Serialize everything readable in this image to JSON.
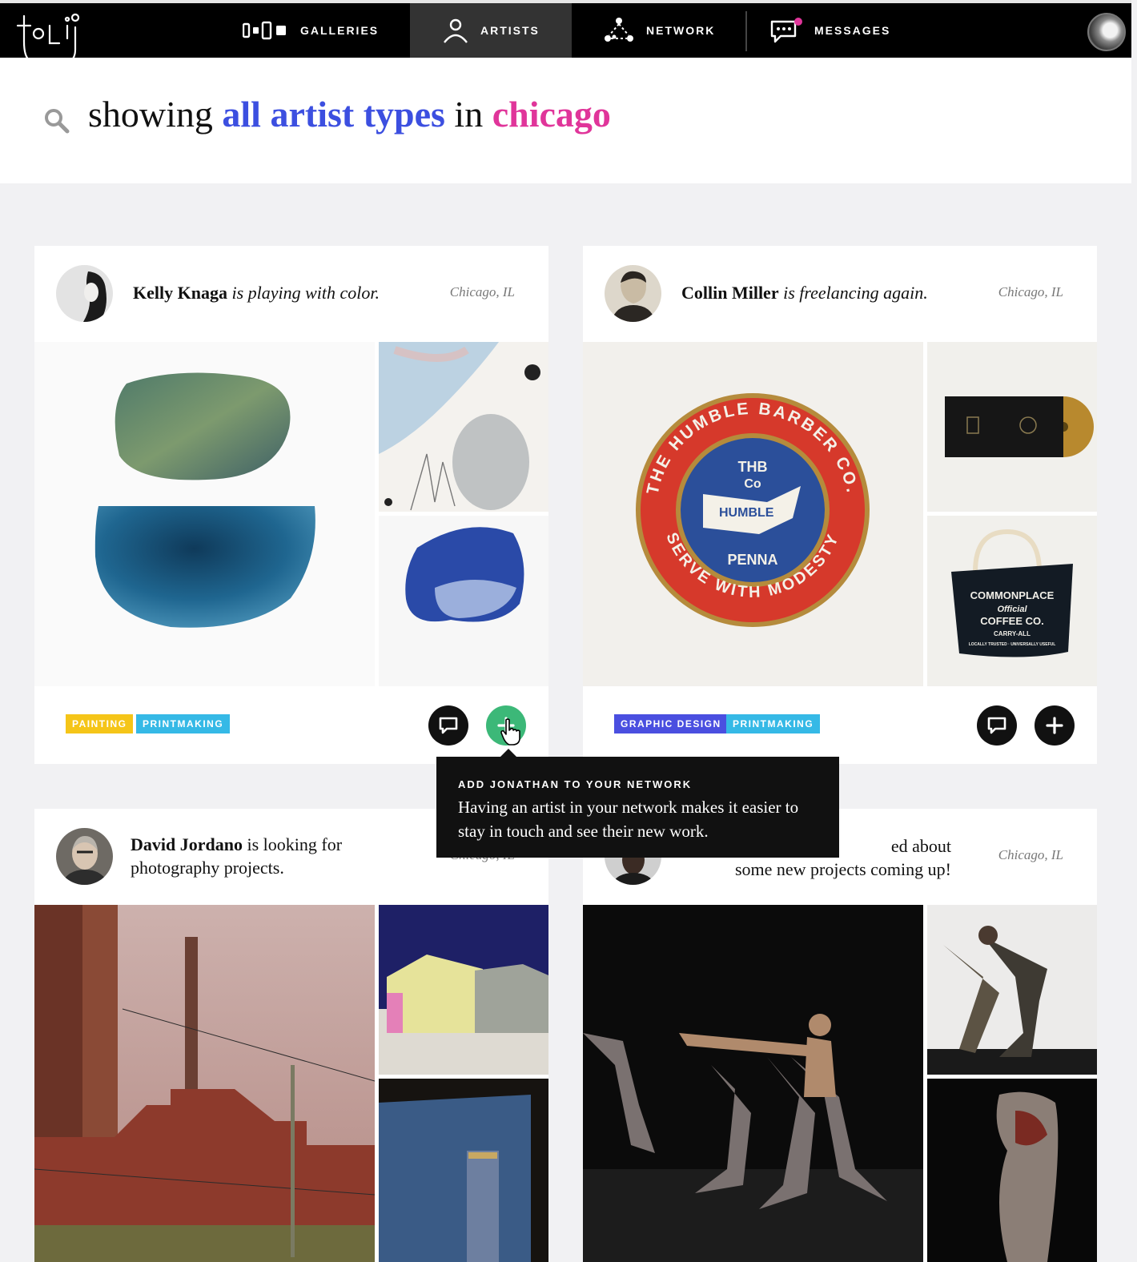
{
  "app": {
    "logo_text": "tolli"
  },
  "nav": {
    "items": [
      {
        "label": "GALLERIES",
        "icon": "galleries-icon"
      },
      {
        "label": "ARTISTS",
        "icon": "artist-icon",
        "active": true
      },
      {
        "label": "NETWORK",
        "icon": "network-icon"
      },
      {
        "label": "MESSAGES",
        "icon": "messages-icon",
        "has_notification": true
      }
    ]
  },
  "search": {
    "prefix": "showing",
    "type": "all artist types",
    "connector": "in",
    "location": "chicago"
  },
  "cards": [
    {
      "name": "Kelly Knaga",
      "status": "is playing with color.",
      "location": "Chicago, IL",
      "tags": [
        "PAINTING",
        "PRINTMAKING"
      ]
    },
    {
      "name": "Collin Miller",
      "status": "is freelancing again.",
      "location": "Chicago, IL",
      "tags": [
        "GRAPHIC DESIGN",
        "PRINTMAKING"
      ]
    },
    {
      "name": "David Jordano",
      "status": "is looking for photography projects.",
      "location": "Chicago, IL"
    },
    {
      "name": "",
      "status_visible": "ed about",
      "status_line2": "some new projects coming up!",
      "location": "Chicago, IL"
    }
  ],
  "tooltip": {
    "title": "ADD JONATHAN TO YOUR NETWORK",
    "body": "Having an artist in your network makes it easier to stay in touch and see their new work."
  },
  "artwork_text": {
    "badge_outer_top": "THE HUMBLE BARBER CO.",
    "badge_outer_bottom": "SERVE WITH MODESTY",
    "badge_center_1": "THB",
    "badge_center_2": "Co",
    "badge_center_3": "HUMBLE",
    "badge_center_4": "PENNA",
    "tote_line_1": "COMMONPLACE",
    "tote_line_2": "Official",
    "tote_line_3": "COFFEE CO.",
    "tote_line_4": "CARRY-ALL",
    "tote_line_5": "LOCALLY TRUSTED · UNIVERSALLY USEFUL"
  },
  "colors": {
    "accent_blue": "#3c4fe0",
    "accent_pink": "#e0359a",
    "tag_painting": "#f5c518",
    "tag_printmaking": "#35b9e6",
    "tag_graphic_design": "#4a4fe0",
    "add_button_active": "#3cb878"
  }
}
